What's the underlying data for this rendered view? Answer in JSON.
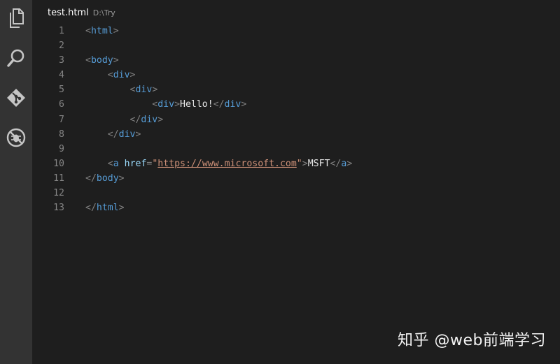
{
  "activity_bar": {
    "items": [
      {
        "icon": "explorer-icon"
      },
      {
        "icon": "search-icon"
      },
      {
        "icon": "git-icon"
      },
      {
        "icon": "debug-icon"
      }
    ]
  },
  "tab": {
    "file_name": "test.html",
    "path": "D:\\Try"
  },
  "code_lines": [
    {
      "number": "1",
      "indent": "",
      "tokens": [
        [
          "punc",
          "<"
        ],
        [
          "tag",
          "html"
        ],
        [
          "punc",
          ">"
        ]
      ]
    },
    {
      "number": "2",
      "indent": "",
      "tokens": []
    },
    {
      "number": "3",
      "indent": "",
      "tokens": [
        [
          "punc",
          "<"
        ],
        [
          "tag",
          "body"
        ],
        [
          "punc",
          ">"
        ]
      ]
    },
    {
      "number": "4",
      "indent": "    ",
      "tokens": [
        [
          "punc",
          "<"
        ],
        [
          "tag",
          "div"
        ],
        [
          "punc",
          ">"
        ]
      ]
    },
    {
      "number": "5",
      "indent": "        ",
      "tokens": [
        [
          "punc",
          "<"
        ],
        [
          "tag",
          "div"
        ],
        [
          "punc",
          ">"
        ]
      ]
    },
    {
      "number": "6",
      "indent": "            ",
      "tokens": [
        [
          "punc",
          "<"
        ],
        [
          "tag",
          "div"
        ],
        [
          "punc",
          ">"
        ],
        [
          "text",
          "Hello!"
        ],
        [
          "punc",
          "</"
        ],
        [
          "tag",
          "div"
        ],
        [
          "punc",
          ">"
        ]
      ]
    },
    {
      "number": "7",
      "indent": "        ",
      "tokens": [
        [
          "punc",
          "</"
        ],
        [
          "tag",
          "div"
        ],
        [
          "punc",
          ">"
        ]
      ]
    },
    {
      "number": "8",
      "indent": "    ",
      "tokens": [
        [
          "punc",
          "</"
        ],
        [
          "tag",
          "div"
        ],
        [
          "punc",
          ">"
        ]
      ]
    },
    {
      "number": "9",
      "indent": "",
      "tokens": []
    },
    {
      "number": "10",
      "indent": "    ",
      "tokens": [
        [
          "punc",
          "<"
        ],
        [
          "tag",
          "a"
        ],
        [
          "text",
          " "
        ],
        [
          "attr",
          "href"
        ],
        [
          "punc",
          "="
        ],
        [
          "str",
          "\""
        ],
        [
          "url",
          "https://www.microsoft.com"
        ],
        [
          "str",
          "\""
        ],
        [
          "punc",
          ">"
        ],
        [
          "text",
          "MSFT"
        ],
        [
          "punc",
          "</"
        ],
        [
          "tag",
          "a"
        ],
        [
          "punc",
          ">"
        ]
      ]
    },
    {
      "number": "11",
      "indent": "",
      "tokens": [
        [
          "punc",
          "</"
        ],
        [
          "tag",
          "body"
        ],
        [
          "punc",
          ">"
        ]
      ]
    },
    {
      "number": "12",
      "indent": "",
      "tokens": []
    },
    {
      "number": "13",
      "indent": "",
      "tokens": [
        [
          "punc",
          "</"
        ],
        [
          "tag",
          "html"
        ],
        [
          "punc",
          ">"
        ]
      ]
    }
  ],
  "watermark": {
    "text": "知乎 @web前端学习"
  },
  "colors": {
    "background": "#1e1e1e",
    "activity_bar": "#333333",
    "tag": "#569cd6",
    "attribute": "#9cdcfe",
    "string": "#ce9178",
    "punctuation": "#808080",
    "line_number": "#858585"
  }
}
